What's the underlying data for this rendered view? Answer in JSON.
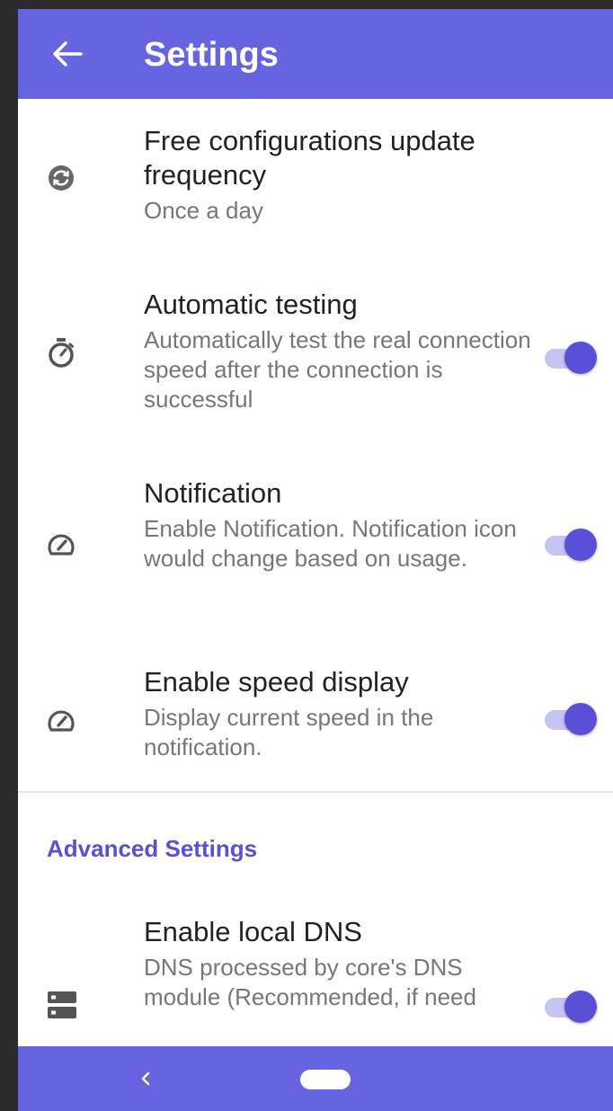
{
  "appbar": {
    "title": "Settings",
    "back_icon": "arrow-left-icon"
  },
  "settings": [
    {
      "icon": "refresh-icon",
      "title": "Free configurations update frequency",
      "subtitle": "Once a day"
    },
    {
      "icon": "stopwatch-icon",
      "title": "Automatic testing",
      "subtitle": "Automatically test the real connection speed after the connection is successful",
      "toggle": true
    },
    {
      "icon": "speedometer-icon",
      "title": "Notification",
      "subtitle": "Enable Notification. Notification icon would change based on usage.",
      "toggle": true
    },
    {
      "icon": "speedometer-icon",
      "title": "Enable speed display",
      "subtitle": "Display current speed in the notification.",
      "toggle": true
    }
  ],
  "advanced": {
    "header": "Advanced Settings",
    "items": [
      {
        "icon": "dns-server-icon",
        "title": "Enable local DNS",
        "subtitle": "DNS processed by core's DNS module (Recommended, if need",
        "toggle": true
      }
    ]
  },
  "colors": {
    "primary": "#6664e0",
    "accent": "#5a4fd8",
    "accent_track": "#c6c3f5"
  },
  "navbar": {
    "back_icon": "chevron-left-icon",
    "home_icon": "home-pill-icon"
  }
}
